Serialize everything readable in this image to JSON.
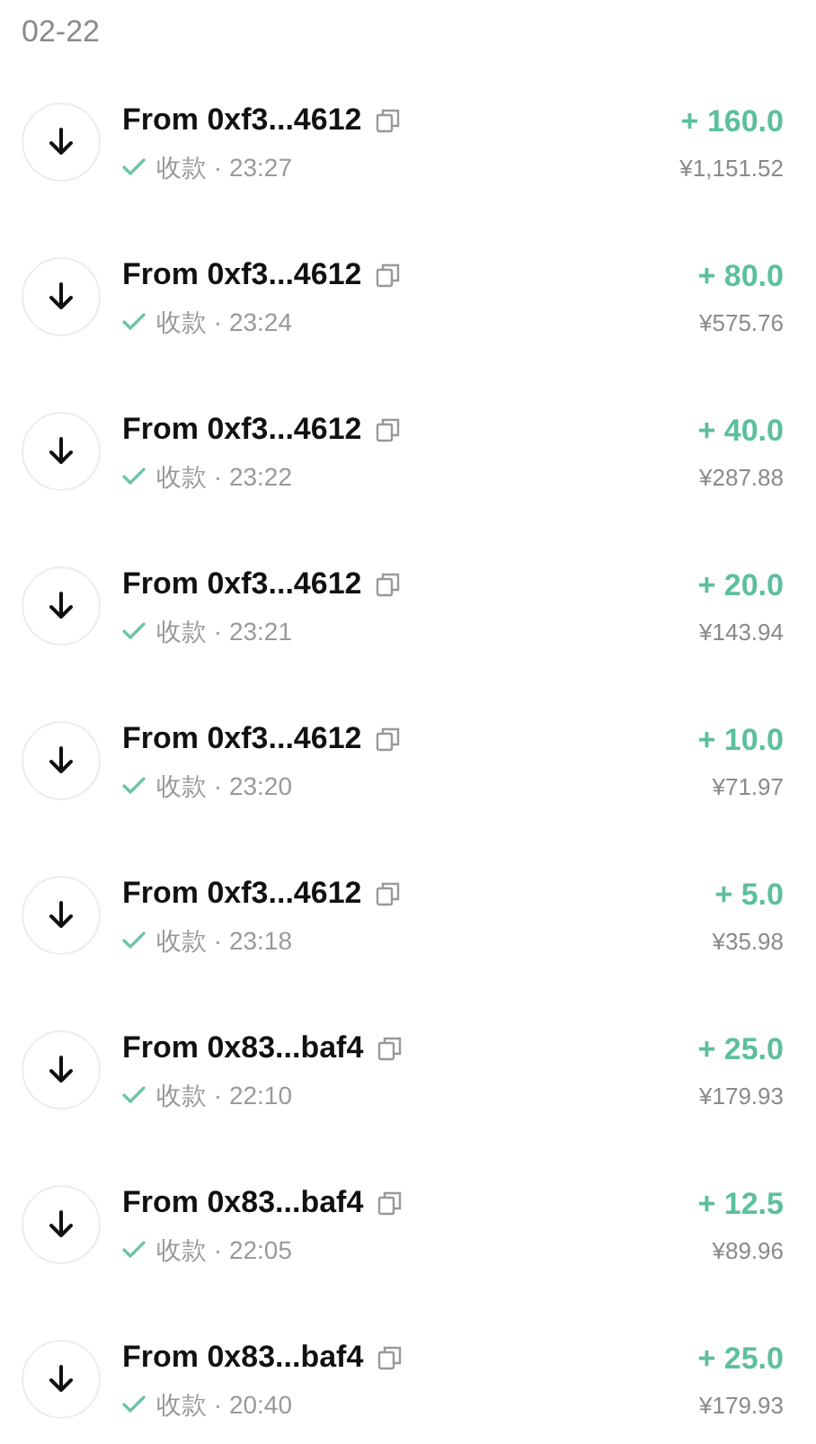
{
  "date": "02-22",
  "transactions": [
    {
      "title": "From 0xf3...4612",
      "detail": "收款 · 23:27",
      "amount": "+ 160.0",
      "fiat": "¥1,151.52"
    },
    {
      "title": "From 0xf3...4612",
      "detail": "收款 · 23:24",
      "amount": "+ 80.0",
      "fiat": "¥575.76"
    },
    {
      "title": "From 0xf3...4612",
      "detail": "收款 · 23:22",
      "amount": "+ 40.0",
      "fiat": "¥287.88"
    },
    {
      "title": "From 0xf3...4612",
      "detail": "收款 · 23:21",
      "amount": "+ 20.0",
      "fiat": "¥143.94"
    },
    {
      "title": "From 0xf3...4612",
      "detail": "收款 · 23:20",
      "amount": "+ 10.0",
      "fiat": "¥71.97"
    },
    {
      "title": "From 0xf3...4612",
      "detail": "收款 · 23:18",
      "amount": "+ 5.0",
      "fiat": "¥35.98"
    },
    {
      "title": "From 0x83...baf4",
      "detail": "收款 · 22:10",
      "amount": "+ 25.0",
      "fiat": "¥179.93"
    },
    {
      "title": "From 0x83...baf4",
      "detail": "收款 · 22:05",
      "amount": "+ 12.5",
      "fiat": "¥89.96"
    },
    {
      "title": "From 0x83...baf4",
      "detail": "收款 · 20:40",
      "amount": "+ 25.0",
      "fiat": "¥179.93"
    }
  ]
}
